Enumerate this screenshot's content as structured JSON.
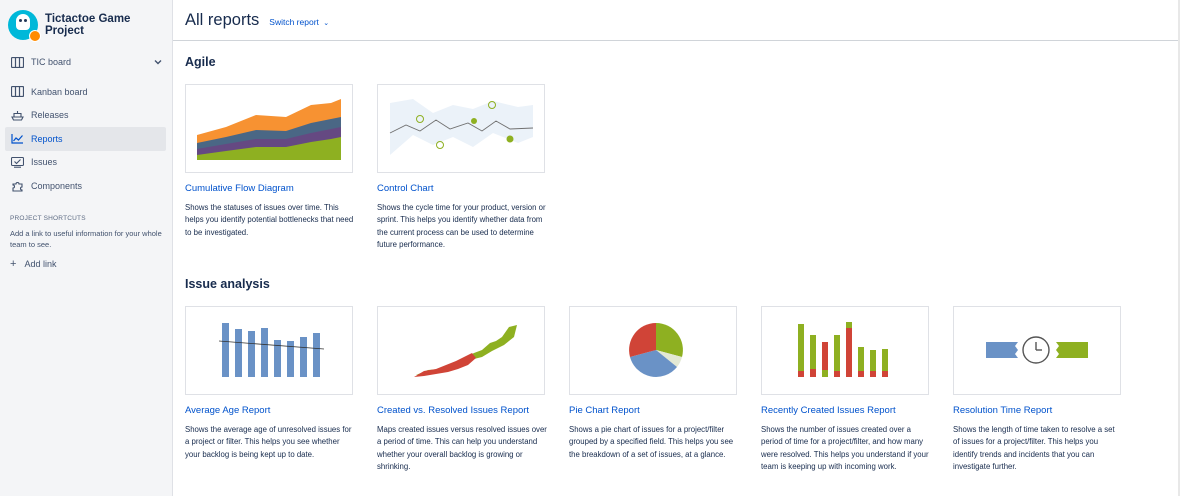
{
  "project": {
    "name": "Tictactoe Game Project"
  },
  "sidebar": {
    "board": {
      "label": "TIC board"
    },
    "items": [
      {
        "label": "Kanban board",
        "icon": "kanban-board-icon"
      },
      {
        "label": "Releases",
        "icon": "ship-icon"
      },
      {
        "label": "Reports",
        "icon": "graph-line-icon"
      },
      {
        "label": "Issues",
        "icon": "issues-icon"
      },
      {
        "label": "Components",
        "icon": "puzzle-icon"
      }
    ],
    "active_item": "Reports",
    "shortcuts": {
      "title": "PROJECT SHORTCUTS",
      "description": "Add a link to useful information for your whole team to see.",
      "add_label": "Add link"
    }
  },
  "header": {
    "title": "All reports",
    "switch_label": "Switch report"
  },
  "sections": {
    "agile": {
      "title": "Agile",
      "cards": [
        {
          "title": "Cumulative Flow Diagram",
          "description": "Shows the statuses of issues over time. This helps you identify potential bottlenecks that need to be investigated."
        },
        {
          "title": "Control Chart",
          "description": "Shows the cycle time for your product, version or sprint. This helps you identify whether data from the current process can be used to determine future performance."
        }
      ]
    },
    "issue_analysis": {
      "title": "Issue analysis",
      "cards": [
        {
          "title": "Average Age Report",
          "description": "Shows the average age of unresolved issues for a project or filter. This helps you see whether your backlog is being kept up to date."
        },
        {
          "title": "Created vs. Resolved Issues Report",
          "description": "Maps created issues versus resolved issues over a period of time. This can help you understand whether your overall backlog is growing or shrinking."
        },
        {
          "title": "Pie Chart Report",
          "description": "Shows a pie chart of issues for a project/filter grouped by a specified field. This helps you see the breakdown of a set of issues, at a glance."
        },
        {
          "title": "Recently Created Issues Report",
          "description": "Shows the number of issues created over a period of time for a project/filter, and how many were resolved. This helps you understand if your team is keeping up with incoming work."
        },
        {
          "title": "Resolution Time Report",
          "description": "Shows the length of time taken to resolve a set of issues for a project/filter. This helps you identify trends and incidents that you can investigate further."
        }
      ]
    }
  },
  "colors": {
    "link": "#0052cc",
    "text": "#172b4d",
    "orange": "#f79232",
    "blue": "#4a6785",
    "green": "#8eb021",
    "red": "#d04437",
    "purple": "#654982"
  }
}
